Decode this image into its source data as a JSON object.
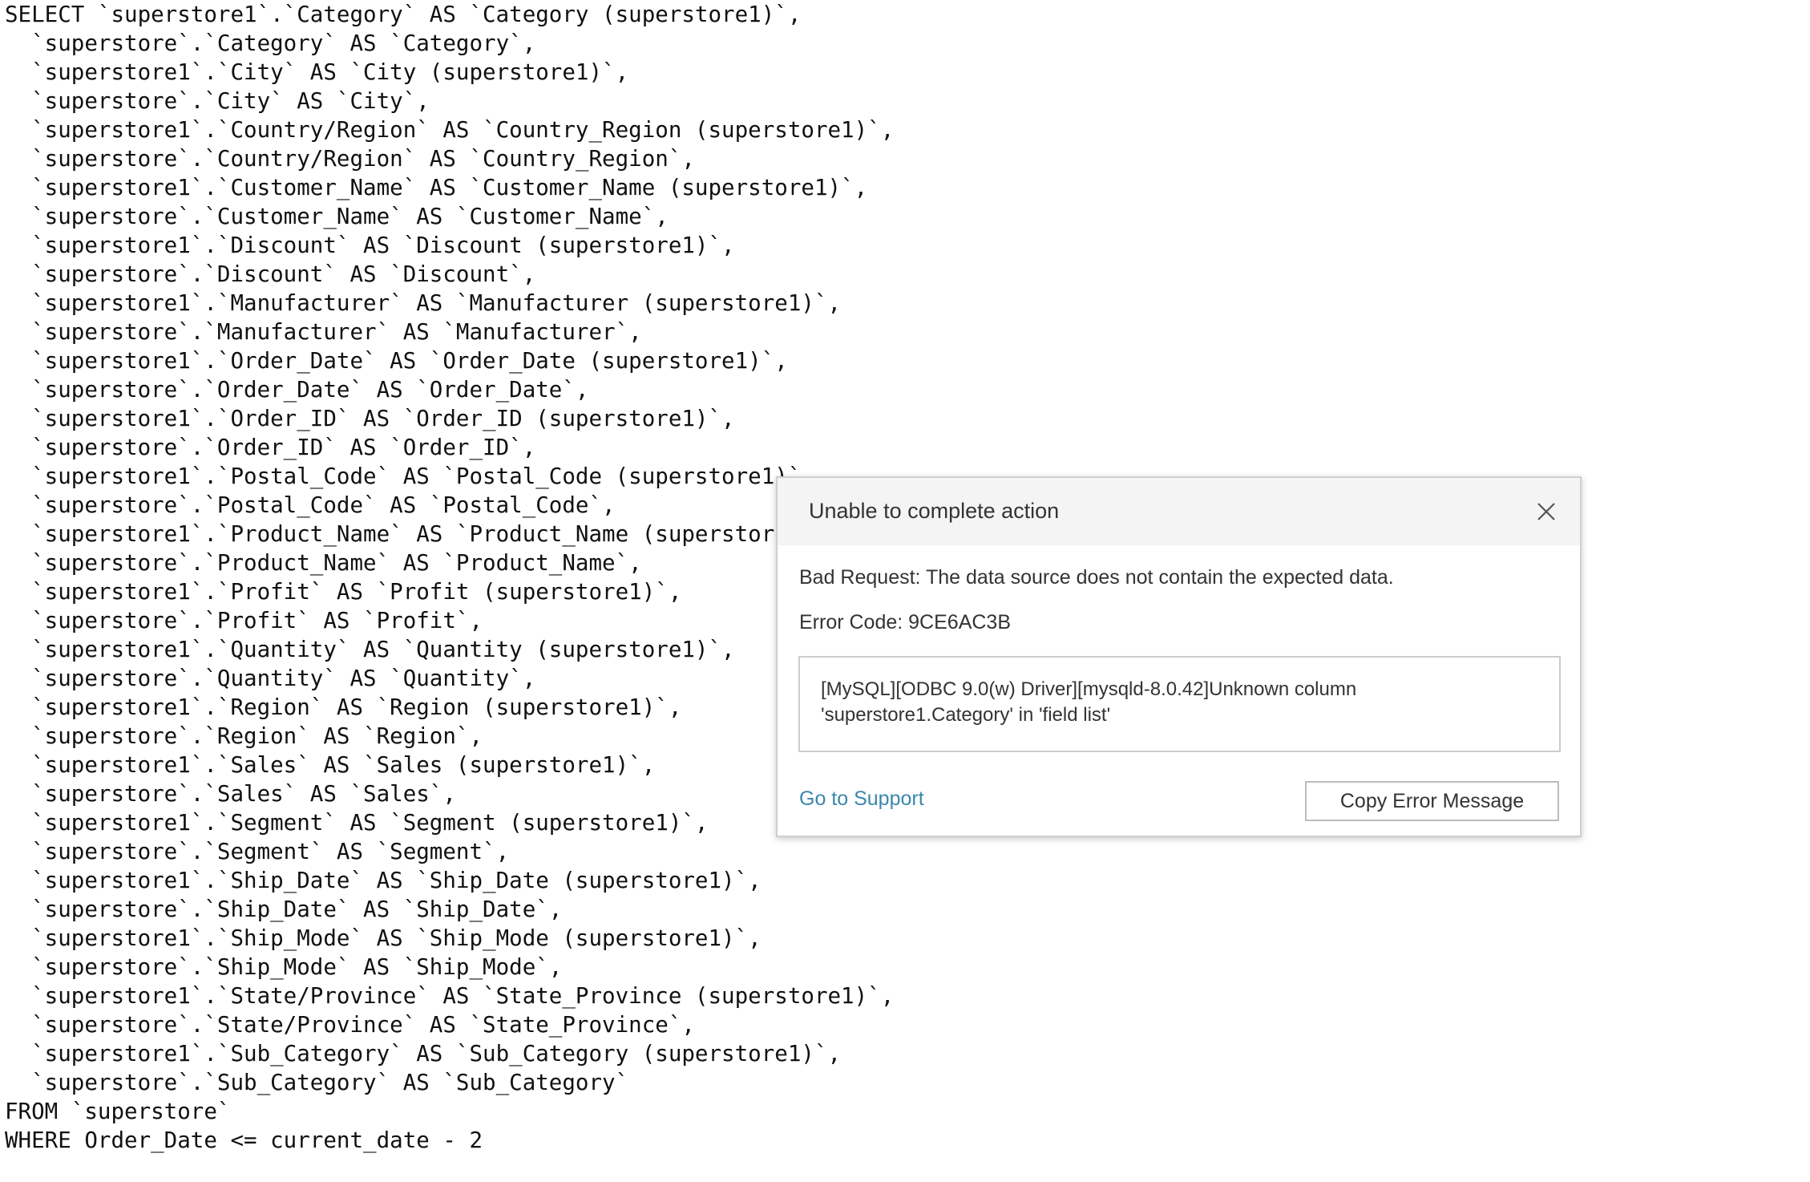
{
  "sql": {
    "lines": [
      "SELECT `superstore1`.`Category` AS `Category (superstore1)`,",
      "  `superstore`.`Category` AS `Category`,",
      "  `superstore1`.`City` AS `City (superstore1)`,",
      "  `superstore`.`City` AS `City`,",
      "  `superstore1`.`Country/Region` AS `Country_Region (superstore1)`,",
      "  `superstore`.`Country/Region` AS `Country_Region`,",
      "  `superstore1`.`Customer_Name` AS `Customer_Name (superstore1)`,",
      "  `superstore`.`Customer_Name` AS `Customer_Name`,",
      "  `superstore1`.`Discount` AS `Discount (superstore1)`,",
      "  `superstore`.`Discount` AS `Discount`,",
      "  `superstore1`.`Manufacturer` AS `Manufacturer (superstore1)`,",
      "  `superstore`.`Manufacturer` AS `Manufacturer`,",
      "  `superstore1`.`Order_Date` AS `Order_Date (superstore1)`,",
      "  `superstore`.`Order_Date` AS `Order_Date`,",
      "  `superstore1`.`Order_ID` AS `Order_ID (superstore1)`,",
      "  `superstore`.`Order_ID` AS `Order_ID`,",
      "  `superstore1`.`Postal_Code` AS `Postal_Code (superstore1)`,",
      "  `superstore`.`Postal_Code` AS `Postal_Code`,",
      "  `superstore1`.`Product_Name` AS `Product_Name (superstore1)`,",
      "  `superstore`.`Product_Name` AS `Product_Name`,",
      "  `superstore1`.`Profit` AS `Profit (superstore1)`,",
      "  `superstore`.`Profit` AS `Profit`,",
      "  `superstore1`.`Quantity` AS `Quantity (superstore1)`,",
      "  `superstore`.`Quantity` AS `Quantity`,",
      "  `superstore1`.`Region` AS `Region (superstore1)`,",
      "  `superstore`.`Region` AS `Region`,",
      "  `superstore1`.`Sales` AS `Sales (superstore1)`,",
      "  `superstore`.`Sales` AS `Sales`,",
      "  `superstore1`.`Segment` AS `Segment (superstore1)`,",
      "  `superstore`.`Segment` AS `Segment`,",
      "  `superstore1`.`Ship_Date` AS `Ship_Date (superstore1)`,",
      "  `superstore`.`Ship_Date` AS `Ship_Date`,",
      "  `superstore1`.`Ship_Mode` AS `Ship_Mode (superstore1)`,",
      "  `superstore`.`Ship_Mode` AS `Ship_Mode`,",
      "  `superstore1`.`State/Province` AS `State_Province (superstore1)`,",
      "  `superstore`.`State/Province` AS `State_Province`,",
      "  `superstore1`.`Sub_Category` AS `Sub_Category (superstore1)`,",
      "  `superstore`.`Sub_Category` AS `Sub_Category`",
      "FROM `superstore`",
      "WHERE Order_Date <= current_date - 2"
    ]
  },
  "dialog": {
    "title": "Unable to complete action",
    "close_icon": "close-icon",
    "error_text": "Bad Request: The data source does not contain the expected data.",
    "error_code": "Error Code: 9CE6AC3B",
    "details": "[MySQL][ODBC 9.0(w) Driver][mysqld-8.0.42]Unknown column 'superstore1.Category' in 'field list'",
    "support_link": "Go to Support",
    "copy_button": "Copy Error Message",
    "colors": {
      "link": "#3a87ad",
      "header_bg": "#f4f4f4",
      "text": "#333333"
    }
  }
}
